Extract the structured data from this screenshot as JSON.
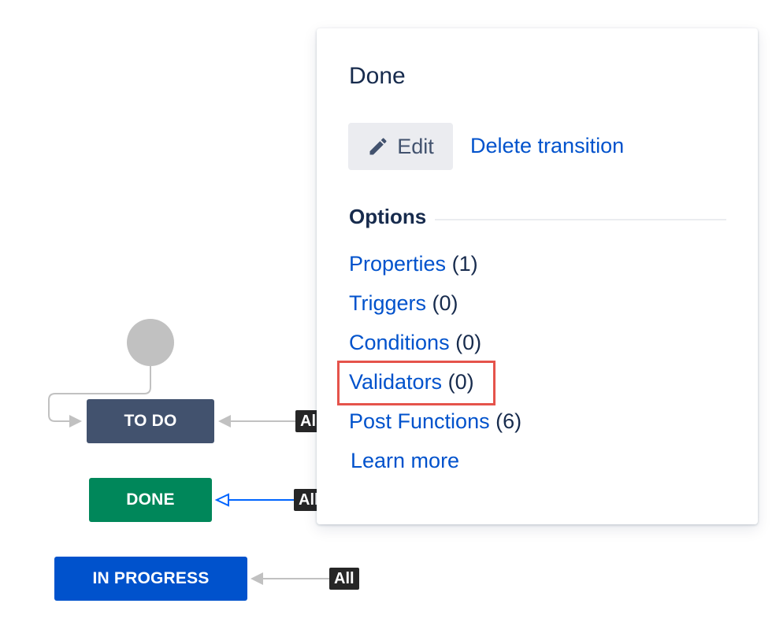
{
  "dialog": {
    "title": "Done",
    "edit_label": "Edit",
    "delete_label": "Delete transition",
    "options_heading": "Options",
    "options": [
      {
        "label": "Properties",
        "count": "(1)"
      },
      {
        "label": "Triggers",
        "count": "(0)"
      },
      {
        "label": "Conditions",
        "count": "(0)"
      },
      {
        "label": "Validators",
        "count": "(0)"
      },
      {
        "label": "Post Functions",
        "count": "(6)"
      }
    ],
    "learn_more": "Learn more",
    "highlighted_option": "Validators"
  },
  "diagram": {
    "statuses": [
      {
        "label": "TO DO",
        "color": "#42526e"
      },
      {
        "label": "DONE",
        "color": "#00875a"
      },
      {
        "label": "IN PROGRESS",
        "color": "#0052cc"
      }
    ],
    "all_badges": [
      {
        "label": "All"
      },
      {
        "label": "All"
      },
      {
        "label": "All"
      }
    ],
    "selected_transition_color": "#0065ff"
  },
  "icons": {
    "edit": "pencil-icon"
  },
  "colors": {
    "link": "#0052cc",
    "highlight_border": "#e5534b"
  }
}
